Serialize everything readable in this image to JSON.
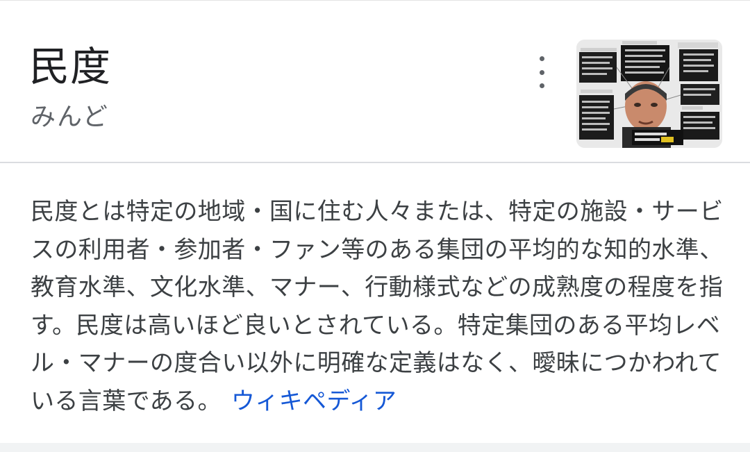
{
  "knowledge_panel": {
    "title": "民度",
    "reading": "みんど",
    "description": "民度とは特定の地域・国に住む人々または、特定の施設・サービスの利用者・参加者・ファン等のある集団の平均的な知的水準、教育水準、文化水準、マナー、行動様式などの成熟度の程度を指す。民度は高いほど良いとされている。特定集団のある平均レベル・マナーの度合い以外に明確な定義はなく、曖昧につかわれている言葉である。",
    "source_link": "ウィキペディア",
    "more_menu_icon": "more-vert-icon",
    "link_color": "#1558d6"
  }
}
